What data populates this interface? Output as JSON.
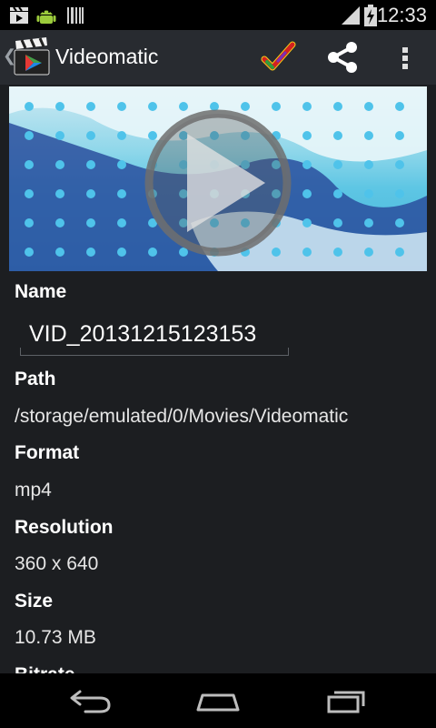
{
  "status_bar": {
    "time": "12:33",
    "notification_icons": [
      "clapperboard-icon",
      "android-icon",
      "barcode-icon"
    ],
    "indicators": [
      "signal-icon",
      "battery-icon"
    ]
  },
  "action_bar": {
    "title": "Videomatic",
    "actions": [
      "checkmark-icon",
      "share-icon",
      "overflow-menu-icon"
    ]
  },
  "video": {
    "overlay_icon": "play-icon"
  },
  "details": {
    "name": {
      "label": "Name",
      "value": "VID_20131215123153"
    },
    "path": {
      "label": "Path",
      "value": "/storage/emulated/0/Movies/Videomatic"
    },
    "format": {
      "label": "Format",
      "value": "mp4"
    },
    "resolution": {
      "label": "Resolution",
      "value": "360 x 640"
    },
    "size": {
      "label": "Size",
      "value": "10.73 MB"
    },
    "bitrate": {
      "label": "Bitrate"
    }
  },
  "nav_bar": {
    "buttons": [
      "back-icon",
      "home-icon",
      "recents-icon"
    ]
  },
  "colors": {
    "background": "#1c1e21",
    "action_bar": "#282b30",
    "status_bar": "#000000",
    "checkmark": "#cc2020"
  }
}
